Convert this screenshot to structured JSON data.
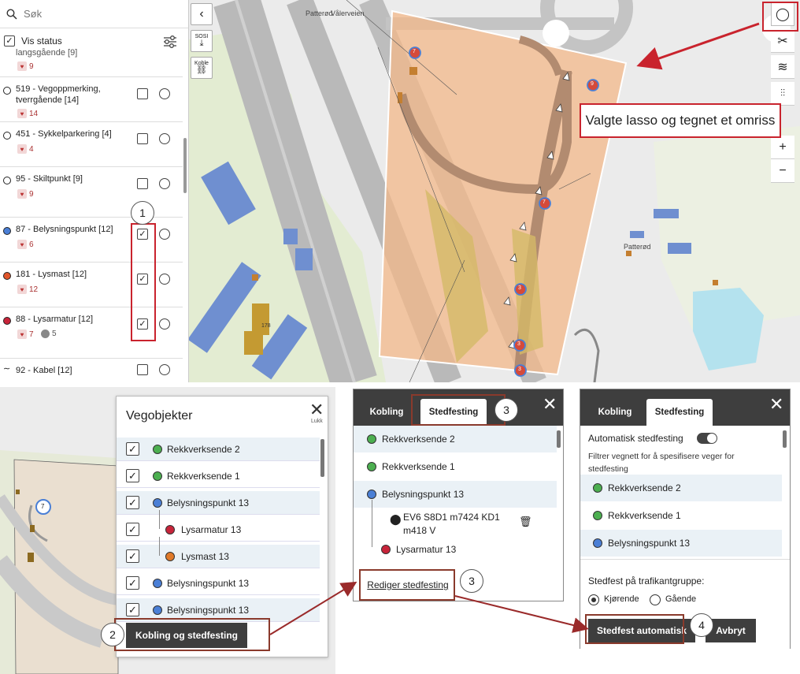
{
  "sidebar": {
    "search_placeholder": "Søk",
    "vis_status_label": "Vis status",
    "partial_item": {
      "title": "langsgående [9]",
      "badge": "9"
    },
    "items": [
      {
        "title": "519 - Vegoppmerking, tverrgående [14]",
        "badge": "14",
        "color": "#ffffff",
        "checked": false
      },
      {
        "title": "451 - Sykkelparkering [4]",
        "badge": "4",
        "color": "#ffffff",
        "checked": false
      },
      {
        "title": "95 - Skiltpunkt [9]",
        "badge": "9",
        "color": "#ffffff",
        "checked": false
      },
      {
        "title": "87 - Belysningspunkt [12]",
        "badge": "6",
        "color": "#4a7fd6",
        "checked": true
      },
      {
        "title": "181 - Lysmast [12]",
        "badge": "12",
        "color": "#e0552a",
        "checked": true
      },
      {
        "title": "88 - Lysarmatur [12]",
        "badge": "7",
        "badge2": "5",
        "color": "#c8243a",
        "checked": true
      }
    ],
    "kabel_item": {
      "title": "92 - Kabel [12]"
    }
  },
  "annotations": {
    "step1": "1",
    "step2": "2",
    "step3a": "3",
    "step3b": "3",
    "step4": "4",
    "lasso_callout": "Valgte lasso og tegnet et omriss"
  },
  "map": {
    "back_icon": "chevron-left-icon",
    "sosi_label": "SOSI",
    "koble_label": "Koble",
    "road_label_1": "Patterød",
    "road_label_2": "Vålerveien",
    "place_label": "Patterød",
    "zoom_in": "+",
    "zoom_out": "−",
    "markers": [
      "7",
      "9",
      "7",
      "3",
      "3",
      "3"
    ],
    "building_label": "178"
  },
  "vegobjekter": {
    "title": "Vegobjekter",
    "close_label": "Lukk",
    "rows": [
      {
        "label": "Rekkverksende 2",
        "color": "#4caf50",
        "indent": 0
      },
      {
        "label": "Rekkverksende 1",
        "color": "#4caf50",
        "indent": 0
      },
      {
        "label": "Belysningspunkt 13",
        "color": "#4a7fd6",
        "indent": 0
      },
      {
        "label": "Lysarmatur 13",
        "color": "#c8243a",
        "indent": 1
      },
      {
        "label": "Lysmast 13",
        "color": "#e07a2a",
        "indent": 1
      },
      {
        "label": "Belysningspunkt 13",
        "color": "#4a7fd6",
        "indent": 0
      },
      {
        "label": "Belysningspunkt 13",
        "color": "#4a7fd6",
        "indent": 0
      }
    ],
    "button_label": "Kobling og stedfesting",
    "bmap_marker": "7"
  },
  "panel_mid": {
    "tab_kobling": "Kobling",
    "tab_stedfesting": "Stedfesting",
    "rows": [
      {
        "label": "Rekkverksende 2",
        "color": "#4caf50"
      },
      {
        "label": "Rekkverksende 1",
        "color": "#4caf50"
      },
      {
        "label": "Belysningspunkt 13",
        "color": "#4a7fd6"
      }
    ],
    "location_text_1": "EV6 S8D1 m7424 KD1",
    "location_text_2": "m418 V",
    "sub_row": {
      "label": "Lysarmatur 13",
      "color": "#c8243a"
    },
    "rediger_label": "Rediger stedfesting"
  },
  "panel_right": {
    "tab_kobling": "Kobling",
    "tab_stedfesting": "Stedfesting",
    "auto_label": "Automatisk stedfesting",
    "filter_text_1": "Filtrer vegnett for å spesifisere veger for",
    "filter_text_2": "stedfesting",
    "rows": [
      {
        "label": "Rekkverksende 2",
        "color": "#4caf50"
      },
      {
        "label": "Rekkverksende 1",
        "color": "#4caf50"
      },
      {
        "label": "Belysningspunkt 13",
        "color": "#4a7fd6"
      }
    ],
    "trafikant_label": "Stedfest på trafikantgruppe:",
    "radio_1": "Kjørende",
    "radio_2": "Gående",
    "btn_auto": "Stedfest automatisk",
    "btn_avbryt": "Avbryt"
  }
}
